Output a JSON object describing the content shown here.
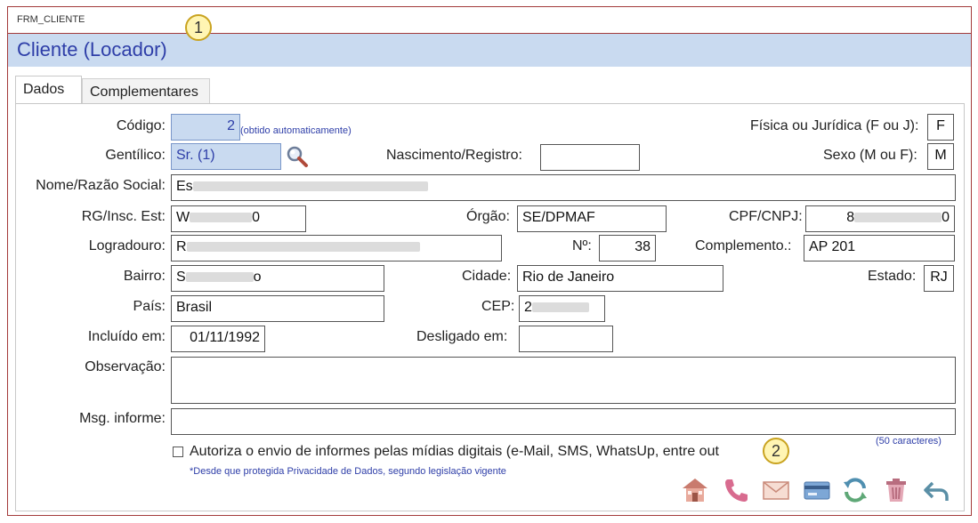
{
  "window": {
    "object_name": "FRM_CLIENTE",
    "title": "Cliente (Locador)"
  },
  "callouts": [
    "1",
    "2"
  ],
  "tabs": [
    {
      "label": "Dados",
      "active": true
    },
    {
      "label": "Complementares",
      "active": false
    }
  ],
  "fields": {
    "codigo": {
      "label": "Código:",
      "value": "2",
      "hint": "(obtido automaticamente)"
    },
    "tipo_pessoa": {
      "label": "Física ou Jurídica (F ou J):",
      "value": "F"
    },
    "gentilico": {
      "label": "Gentílico:",
      "value": "Sr. (1)"
    },
    "nascimento": {
      "label": "Nascimento/Registro:",
      "value": ""
    },
    "sexo": {
      "label": "Sexo (M ou F):",
      "value": "M"
    },
    "nome": {
      "label": "Nome/Razão Social:",
      "value": "Es"
    },
    "rg": {
      "label": "RG/Insc. Est:",
      "value_start": "W",
      "value_end": "0"
    },
    "orgao": {
      "label": "Órgão:",
      "value": "SE/DPMAF"
    },
    "cpf": {
      "label": "CPF/CNPJ:",
      "value_start": "8",
      "value_end": "0"
    },
    "logradouro": {
      "label": "Logradouro:",
      "value": "R"
    },
    "numero": {
      "label": "Nº:",
      "value": "38"
    },
    "complemento": {
      "label": "Complemento.:",
      "value": "AP 201"
    },
    "bairro": {
      "label": "Bairro:",
      "value_start": "S",
      "value_end": "o"
    },
    "cidade": {
      "label": "Cidade:",
      "value": "Rio de Janeiro"
    },
    "estado": {
      "label": "Estado:",
      "value": "RJ"
    },
    "pais": {
      "label": "País:",
      "value": "Brasil"
    },
    "cep": {
      "label": "CEP:",
      "value": "2"
    },
    "incluido": {
      "label": "Incluído em:",
      "value": "01/11/1992"
    },
    "desligado": {
      "label": "Desligado em:",
      "value": ""
    },
    "observacao": {
      "label": "Observação:",
      "value": ""
    },
    "msg_informe": {
      "label": "Msg. informe:",
      "value": "",
      "hint": "(50 caracteres)"
    }
  },
  "consent": {
    "label": "Autoriza o envio de informes pelas mídias digitais (e-Mail, SMS, WhatsUp, entre out",
    "checked": false,
    "note": "*Desde que protegida Privacidade de Dados, segundo legislação vigente"
  },
  "toolbar_icons": [
    "house-icon",
    "phone-icon",
    "envelope-icon",
    "card-icon",
    "refresh-icon",
    "trash-icon",
    "undo-arrow-icon"
  ]
}
